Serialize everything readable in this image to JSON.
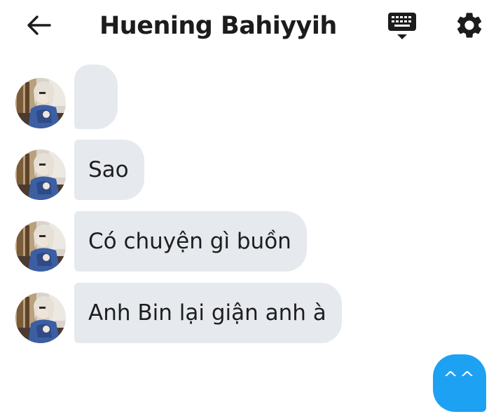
{
  "header": {
    "title": "Huening Bahiyyih",
    "back_icon": "arrow-left-icon",
    "keyboard_icon": "keyboard-icon",
    "settings_icon": "gear-icon"
  },
  "messages": [
    {
      "sender": "Huening Bahiyyih",
      "text": ""
    },
    {
      "sender": "Huening Bahiyyih",
      "text": "Sao"
    },
    {
      "sender": "Huening Bahiyyih",
      "text": "Có chuyện gì buồn"
    },
    {
      "sender": "Huening Bahiyyih",
      "text": "Anh Bin lại giận anh à"
    }
  ],
  "reply": {
    "text": "^^",
    "color": "#1da1f2"
  },
  "colors": {
    "incoming_bubble": "#e6e9ee",
    "accent": "#1da1f2",
    "text": "#1c1c1c"
  }
}
